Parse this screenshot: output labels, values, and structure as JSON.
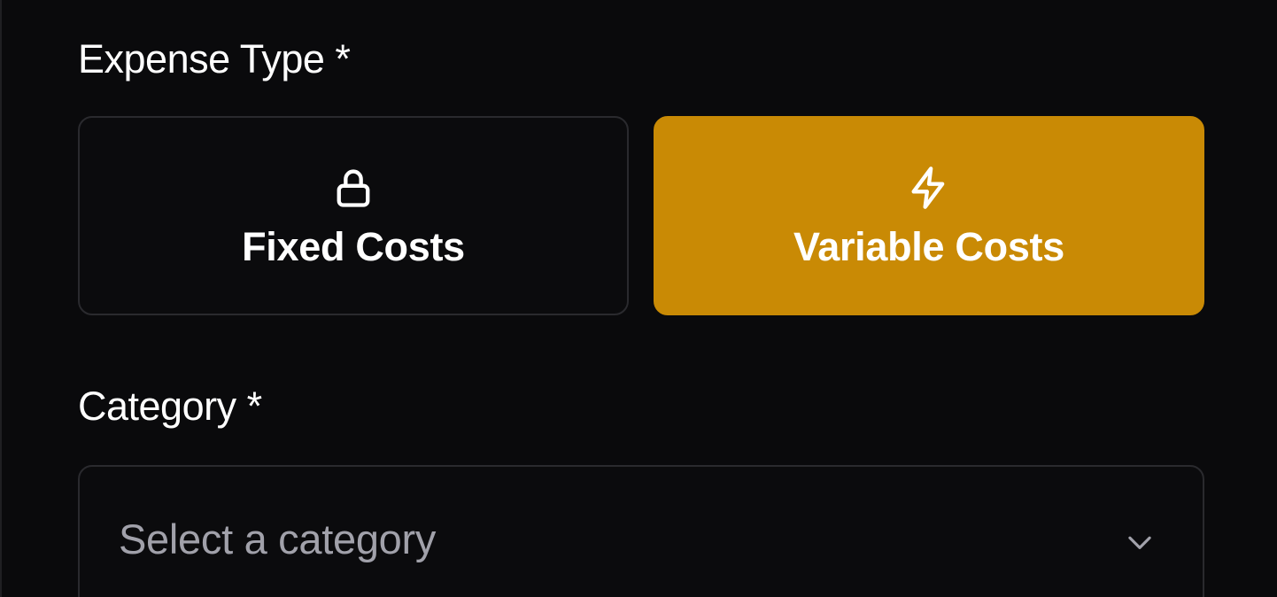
{
  "form": {
    "expense_type_label": "Expense Type *",
    "category_label": "Category *",
    "expense_types": [
      {
        "label": "Fixed Costs",
        "icon": "lock-icon",
        "selected": false
      },
      {
        "label": "Variable Costs",
        "icon": "lightning-icon",
        "selected": true
      }
    ],
    "category": {
      "placeholder": "Select a category",
      "value": ""
    }
  },
  "colors": {
    "background": "#0a0a0c",
    "accent": "#c98a05",
    "border": "#2a2a2e",
    "placeholder_text": "#a1a1aa"
  }
}
